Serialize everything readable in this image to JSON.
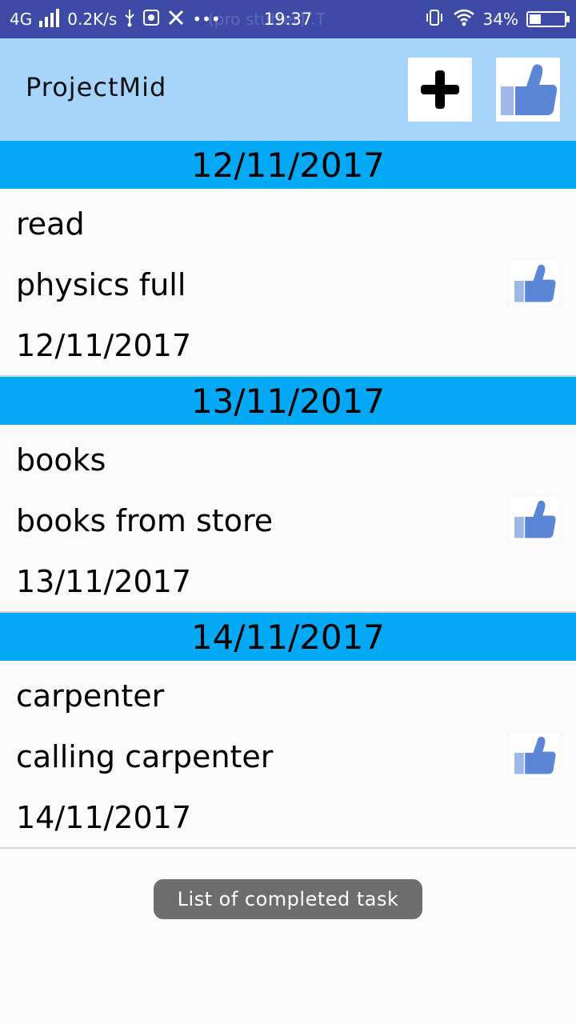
{
  "status_bar": {
    "network": "4G",
    "speed": "0.2K/s",
    "time": "19:37",
    "ghost_text": "(pro stutter) .T",
    "battery": "34%",
    "battery_level": 0.34
  },
  "app_bar": {
    "title": "ProjectMid",
    "add_icon": "plus-icon",
    "like_icon": "thumbs-up-icon"
  },
  "groups": [
    {
      "date_header": "12/11/2017",
      "task": {
        "title": "read",
        "description": "physics full",
        "date": "12/11/2017"
      }
    },
    {
      "date_header": "13/11/2017",
      "task": {
        "title": "books",
        "description": "books from store",
        "date": "13/11/2017"
      }
    },
    {
      "date_header": "14/11/2017",
      "task": {
        "title": "carpenter",
        "description": "calling carpenter",
        "date": "14/11/2017"
      }
    }
  ],
  "toast": "List of completed task",
  "colors": {
    "status_bar": "#3d4aa6",
    "app_bar": "#a6d4fb",
    "date_header": "#03a9f4",
    "thumb": "#5b86d6"
  }
}
